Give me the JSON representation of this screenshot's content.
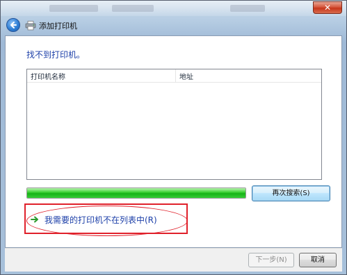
{
  "window": {
    "title": "添加打印机",
    "close_label": "✕"
  },
  "main": {
    "heading": "找不到打印机。",
    "columns": [
      "打印机名称",
      "地址"
    ],
    "progress_percent": 100,
    "research_button": "再次搜索(S)",
    "not_listed_link": "我需要的打印机不在列表中(R)"
  },
  "footer": {
    "next_button": "下一步(N)",
    "cancel_button": "取消"
  },
  "colors": {
    "heading": "#1c3fa8",
    "link": "#1c3fa8",
    "progress": "#17b317",
    "annotation": "#e0202a"
  },
  "icons": {
    "back": "back-arrow-icon",
    "printer": "printer-icon",
    "link_arrow": "green-arrow-icon",
    "close": "close-icon"
  }
}
